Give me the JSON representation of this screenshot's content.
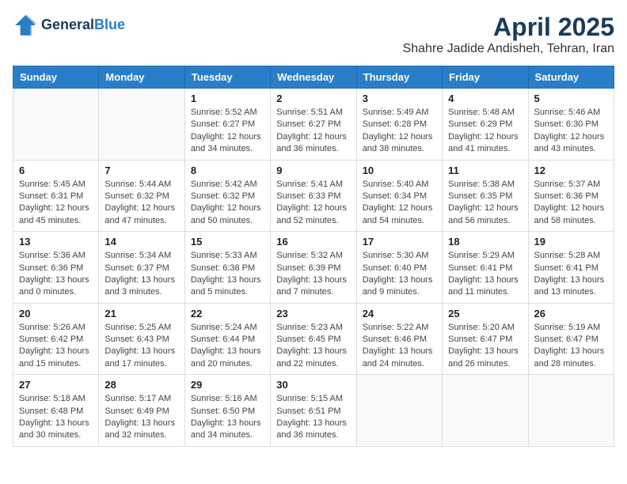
{
  "header": {
    "logo_line1": "General",
    "logo_line2": "Blue",
    "title": "April 2025",
    "subtitle": "Shahre Jadide Andisheh, Tehran, Iran"
  },
  "weekdays": [
    "Sunday",
    "Monday",
    "Tuesday",
    "Wednesday",
    "Thursday",
    "Friday",
    "Saturday"
  ],
  "weeks": [
    [
      {
        "day": "",
        "info": ""
      },
      {
        "day": "",
        "info": ""
      },
      {
        "day": "1",
        "info": "Sunrise: 5:52 AM\nSunset: 6:27 PM\nDaylight: 12 hours and 34 minutes."
      },
      {
        "day": "2",
        "info": "Sunrise: 5:51 AM\nSunset: 6:27 PM\nDaylight: 12 hours and 36 minutes."
      },
      {
        "day": "3",
        "info": "Sunrise: 5:49 AM\nSunset: 6:28 PM\nDaylight: 12 hours and 38 minutes."
      },
      {
        "day": "4",
        "info": "Sunrise: 5:48 AM\nSunset: 6:29 PM\nDaylight: 12 hours and 41 minutes."
      },
      {
        "day": "5",
        "info": "Sunrise: 5:46 AM\nSunset: 6:30 PM\nDaylight: 12 hours and 43 minutes."
      }
    ],
    [
      {
        "day": "6",
        "info": "Sunrise: 5:45 AM\nSunset: 6:31 PM\nDaylight: 12 hours and 45 minutes."
      },
      {
        "day": "7",
        "info": "Sunrise: 5:44 AM\nSunset: 6:32 PM\nDaylight: 12 hours and 47 minutes."
      },
      {
        "day": "8",
        "info": "Sunrise: 5:42 AM\nSunset: 6:32 PM\nDaylight: 12 hours and 50 minutes."
      },
      {
        "day": "9",
        "info": "Sunrise: 5:41 AM\nSunset: 6:33 PM\nDaylight: 12 hours and 52 minutes."
      },
      {
        "day": "10",
        "info": "Sunrise: 5:40 AM\nSunset: 6:34 PM\nDaylight: 12 hours and 54 minutes."
      },
      {
        "day": "11",
        "info": "Sunrise: 5:38 AM\nSunset: 6:35 PM\nDaylight: 12 hours and 56 minutes."
      },
      {
        "day": "12",
        "info": "Sunrise: 5:37 AM\nSunset: 6:36 PM\nDaylight: 12 hours and 58 minutes."
      }
    ],
    [
      {
        "day": "13",
        "info": "Sunrise: 5:36 AM\nSunset: 6:36 PM\nDaylight: 13 hours and 0 minutes."
      },
      {
        "day": "14",
        "info": "Sunrise: 5:34 AM\nSunset: 6:37 PM\nDaylight: 13 hours and 3 minutes."
      },
      {
        "day": "15",
        "info": "Sunrise: 5:33 AM\nSunset: 6:38 PM\nDaylight: 13 hours and 5 minutes."
      },
      {
        "day": "16",
        "info": "Sunrise: 5:32 AM\nSunset: 6:39 PM\nDaylight: 13 hours and 7 minutes."
      },
      {
        "day": "17",
        "info": "Sunrise: 5:30 AM\nSunset: 6:40 PM\nDaylight: 13 hours and 9 minutes."
      },
      {
        "day": "18",
        "info": "Sunrise: 5:29 AM\nSunset: 6:41 PM\nDaylight: 13 hours and 11 minutes."
      },
      {
        "day": "19",
        "info": "Sunrise: 5:28 AM\nSunset: 6:41 PM\nDaylight: 13 hours and 13 minutes."
      }
    ],
    [
      {
        "day": "20",
        "info": "Sunrise: 5:26 AM\nSunset: 6:42 PM\nDaylight: 13 hours and 15 minutes."
      },
      {
        "day": "21",
        "info": "Sunrise: 5:25 AM\nSunset: 6:43 PM\nDaylight: 13 hours and 17 minutes."
      },
      {
        "day": "22",
        "info": "Sunrise: 5:24 AM\nSunset: 6:44 PM\nDaylight: 13 hours and 20 minutes."
      },
      {
        "day": "23",
        "info": "Sunrise: 5:23 AM\nSunset: 6:45 PM\nDaylight: 13 hours and 22 minutes."
      },
      {
        "day": "24",
        "info": "Sunrise: 5:22 AM\nSunset: 6:46 PM\nDaylight: 13 hours and 24 minutes."
      },
      {
        "day": "25",
        "info": "Sunrise: 5:20 AM\nSunset: 6:47 PM\nDaylight: 13 hours and 26 minutes."
      },
      {
        "day": "26",
        "info": "Sunrise: 5:19 AM\nSunset: 6:47 PM\nDaylight: 13 hours and 28 minutes."
      }
    ],
    [
      {
        "day": "27",
        "info": "Sunrise: 5:18 AM\nSunset: 6:48 PM\nDaylight: 13 hours and 30 minutes."
      },
      {
        "day": "28",
        "info": "Sunrise: 5:17 AM\nSunset: 6:49 PM\nDaylight: 13 hours and 32 minutes."
      },
      {
        "day": "29",
        "info": "Sunrise: 5:16 AM\nSunset: 6:50 PM\nDaylight: 13 hours and 34 minutes."
      },
      {
        "day": "30",
        "info": "Sunrise: 5:15 AM\nSunset: 6:51 PM\nDaylight: 13 hours and 36 minutes."
      },
      {
        "day": "",
        "info": ""
      },
      {
        "day": "",
        "info": ""
      },
      {
        "day": "",
        "info": ""
      }
    ]
  ]
}
